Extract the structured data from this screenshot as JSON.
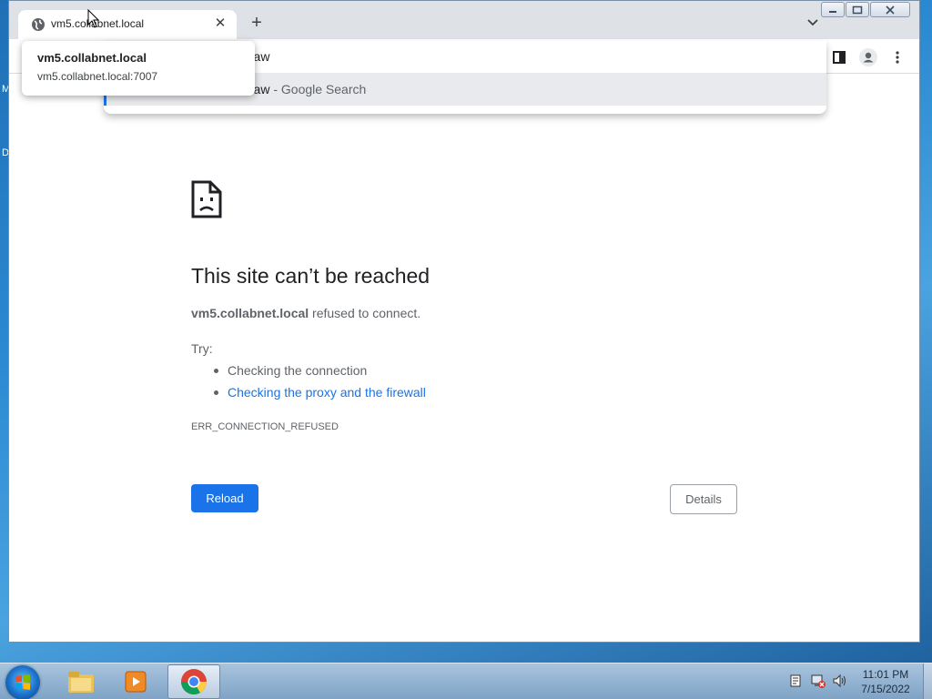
{
  "desktop": {
    "sliver_labels": [
      "M",
      "D"
    ]
  },
  "browser": {
    "tab": {
      "title": "vm5.collabnet.local"
    },
    "hover_card": {
      "title": "vm5.collabnet.local",
      "url": "vm5.collabnet.local:7007"
    },
    "omnibox": {
      "input_text": "fraw",
      "suggestion_query": "fraw",
      "suggestion_suffix": " - Google Search"
    },
    "icons": {
      "tab_favicon": "globe-icon",
      "new_tab": "plus-icon",
      "tab_search": "chevron-down-icon",
      "side_panel": "side-panel-icon",
      "profile": "profile-icon",
      "menu": "kebab-menu-icon"
    }
  },
  "error_page": {
    "title": "This site can’t be reached",
    "host": "vm5.collabnet.local",
    "message": " refused to connect.",
    "try_label": "Try:",
    "suggestions": [
      "Checking the connection",
      "Checking the proxy and the firewall"
    ],
    "error_code": "ERR_CONNECTION_REFUSED",
    "reload_label": "Reload",
    "details_label": "Details"
  },
  "taskbar": {
    "items": [
      "start-orb",
      "file-explorer",
      "media-player",
      "chrome"
    ],
    "active_item": "chrome",
    "time": "11:01 PM",
    "date": "7/15/2022"
  },
  "colors": {
    "accent": "#1a73e8",
    "text_primary": "#202124",
    "text_secondary": "#5f6368",
    "toolbar": "#dee1e6"
  }
}
